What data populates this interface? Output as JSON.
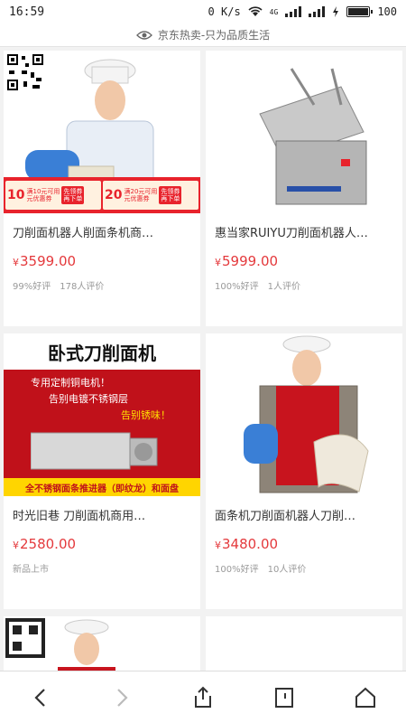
{
  "status": {
    "time": "16:59",
    "speed": "0 K/s",
    "network": "4G",
    "battery": "100"
  },
  "url_bar": {
    "text": "京东热卖-只为品质生活"
  },
  "products": [
    {
      "title": "刀削面机器人削面条机商…",
      "price": "3599.00",
      "currency": "¥",
      "rating": "99%好评",
      "reviews": "178人评价"
    },
    {
      "title": "惠当家RUIYU刀削面机器人…",
      "price": "5999.00",
      "currency": "¥",
      "rating": "100%好评",
      "reviews": "1人评价"
    },
    {
      "title": "时光旧巷 刀削面机商用…",
      "price": "2580.00",
      "currency": "¥",
      "rating": "新品上市",
      "reviews": ""
    },
    {
      "title": "面条机刀削面机器人刀削…",
      "price": "3480.00",
      "currency": "¥",
      "rating": "100%好评",
      "reviews": "10人评价"
    }
  ],
  "coupons": [
    {
      "amount": "10",
      "line1": "满10元可用",
      "line2": "元优惠券",
      "tag1": "先领券",
      "tag2": "再下单"
    },
    {
      "amount": "20",
      "line1": "满20元可用",
      "line2": "元优惠券",
      "tag1": "先领券",
      "tag2": "再下单"
    }
  ],
  "banner": {
    "title": "卧式刀削面机",
    "line1": "专用定制铜电机！",
    "line2": "告别电镀不锈钢层",
    "line3": "告别锈味！",
    "bottom": "全不锈钢面条推进器（即纹龙）和面盘"
  },
  "nav": {
    "back": "back-icon",
    "forward": "forward-icon",
    "share": "share-icon",
    "tabs": "tabs-icon",
    "home": "home-icon"
  },
  "colors": {
    "price": "#e4393c",
    "coupon_red": "#e8232c",
    "banner_red": "#c0111a"
  }
}
